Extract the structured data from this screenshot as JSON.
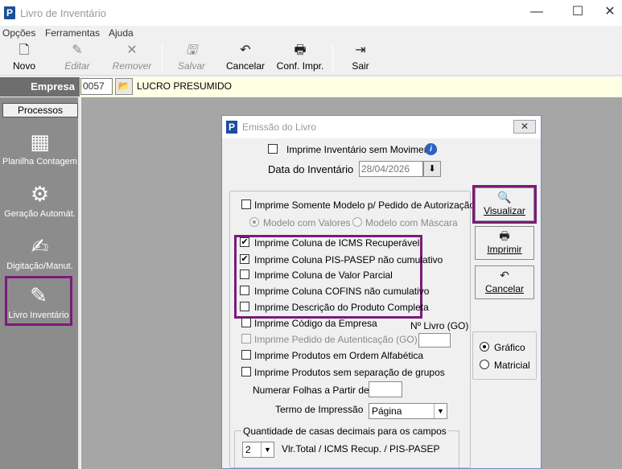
{
  "window": {
    "logo": "P",
    "title": "Livro de Inventário",
    "minimize": "—",
    "maximize": "☐",
    "close": "✕"
  },
  "menu": [
    "Opções",
    "Ferramentas",
    "Ajuda"
  ],
  "toolbar": {
    "novo": "Novo",
    "editar": "Editar",
    "remover": "Remover",
    "salvar": "Salvar",
    "cancelar": "Cancelar",
    "conf": "Conf. Impr.",
    "sair": "Sair"
  },
  "empresa": {
    "label": "Empresa",
    "code": "0057",
    "name": "LUCRO PRESUMIDO"
  },
  "processos": {
    "header": "Processos",
    "items": [
      "Planilha Contagem",
      "Geração Automát.",
      "Digitação/Manut.",
      "Livro Inventário"
    ]
  },
  "dialog": {
    "logo": "P",
    "title": "Emissão do Livro",
    "close": "✕",
    "sem_movimento": "Imprime Inventário sem Movimento",
    "data_label": "Data do Inventário",
    "data_value": "28/04/2026",
    "somente_modelo": "Imprime Somente Modelo p/ Pedido de Autorização",
    "modelo_valores": "Modelo com Valores",
    "modelo_mascara": "Modelo com Máscara",
    "opcoes": [
      "Imprime Coluna de ICMS Recuperável",
      "Imprime Coluna PIS-PASEP não cumulativo",
      "Imprime Coluna de Valor Parcial",
      "Imprime Coluna COFINS não cumulativo",
      "Imprime Descrição do Produto Completa",
      "Imprime Código da Empresa",
      "Imprime Pedido de Autenticação (GO)",
      "Imprime Produtos em Ordem Alfabética",
      "Imprime Produtos sem separação de grupos"
    ],
    "nro_livro_label": "Nº Livro (GO)",
    "numerar_label": "Numerar Folhas a Partir de :",
    "termo_label": "Termo de Impressão",
    "termo_value": "Página",
    "decimais_label": "Quantidade de casas decimais para os campos",
    "decimais_value": "2",
    "decimais_desc": "Vlr.Total / ICMS Recup. / PIS-PASEP",
    "btn_visualizar": "Visualizar",
    "btn_imprimir": "Imprimir",
    "btn_cancelar": "Cancelar",
    "modo_grafico": "Gráfico",
    "modo_matricial": "Matricial"
  },
  "colors": {
    "highlight": "#7b1a7b",
    "empresa_bg": "#ffffe4",
    "panel_bg": "#8c8c8c"
  }
}
